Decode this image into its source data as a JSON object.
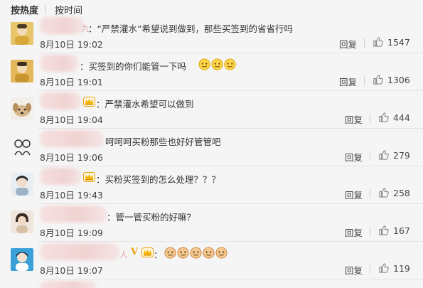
{
  "sort": {
    "hot": "按热度",
    "time": "按时间"
  },
  "comments": [
    {
      "name_tail": "九",
      "text": "：“严禁灌水”希望说到做到，那些买签到的省省行吗",
      "time": "8月10日 19:02",
      "reply": "回复",
      "likes": "1547",
      "vip": false,
      "emoji_count": 0
    },
    {
      "name_tail": "",
      "text": "：买签到的你们能管一下吗",
      "time": "8月10日 19:01",
      "reply": "回复",
      "likes": "1306",
      "vip": false,
      "emoji_count": 3
    },
    {
      "name_tail": "",
      "text": "：严禁灌水希望可以做到",
      "time": "8月10日 19:04",
      "reply": "回复",
      "likes": "444",
      "vip": true,
      "emoji_count": 0
    },
    {
      "name_tail": "",
      "text": "呵呵呵买粉那些也好好管管吧",
      "time": "8月10日 19:06",
      "reply": "回复",
      "likes": "279",
      "vip": false,
      "emoji_count": 0
    },
    {
      "name_tail": "",
      "text": "：买粉买签到的怎么处理？？？",
      "time": "8月10日 19:43",
      "reply": "回复",
      "likes": "258",
      "vip": true,
      "emoji_count": 0
    },
    {
      "name_tail": "",
      "text": "：管一管买粉的好嘛？",
      "time": "8月10日 19:09",
      "reply": "回复",
      "likes": "167",
      "vip": false,
      "emoji_count": 0
    },
    {
      "name_tail": "人",
      "text": "：",
      "time": "8月10日 19:07",
      "reply": "回复",
      "likes": "119",
      "vip": true,
      "vbadge": "V",
      "emoji_count": 5
    }
  ],
  "icons": {
    "like": "thumbs-up-icon",
    "vip": "vip-crown-icon",
    "emoji": "doge-emoji-icon"
  },
  "colors": {
    "background": "#f5f5f5",
    "divider": "#e4e4e4",
    "vip": "#e9a10a",
    "name_blur": "#f0cfcf"
  }
}
